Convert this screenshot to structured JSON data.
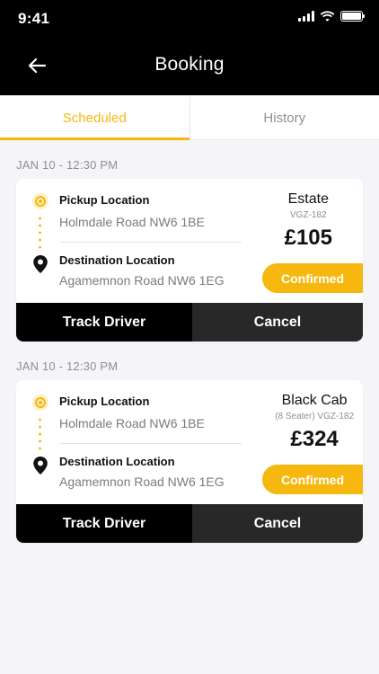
{
  "status_bar": {
    "time": "9:41"
  },
  "header": {
    "title": "Booking"
  },
  "tabs": [
    {
      "label": "Scheduled",
      "active": true
    },
    {
      "label": "History",
      "active": false
    }
  ],
  "bookings": [
    {
      "date": "JAN 10 - 12:30 PM",
      "pickup_label": "Pickup Location",
      "pickup_value": "Holmdale Road NW6 1BE",
      "destination_label": "Destination Location",
      "destination_value": "Agamemnon Road NW6 1EG",
      "vehicle": "Estate",
      "plate": "VGZ-182",
      "price": "£105",
      "status": "Confirmed",
      "track_label": "Track Driver",
      "cancel_label": "Cancel"
    },
    {
      "date": "JAN 10 - 12:30 PM",
      "pickup_label": "Pickup Location",
      "pickup_value": "Holmdale Road NW6 1BE",
      "destination_label": "Destination Location",
      "destination_value": "Agamemnon Road NW6 1EG",
      "vehicle": "Black Cab",
      "plate": "(8 Seater) VGZ-182",
      "price": "£324",
      "status": "Confirmed",
      "track_label": "Track Driver",
      "cancel_label": "Cancel"
    }
  ],
  "colors": {
    "accent": "#f6b80f",
    "header_bg": "#000000",
    "page_bg": "#f4f4f9",
    "cancel_bg": "#282828"
  }
}
